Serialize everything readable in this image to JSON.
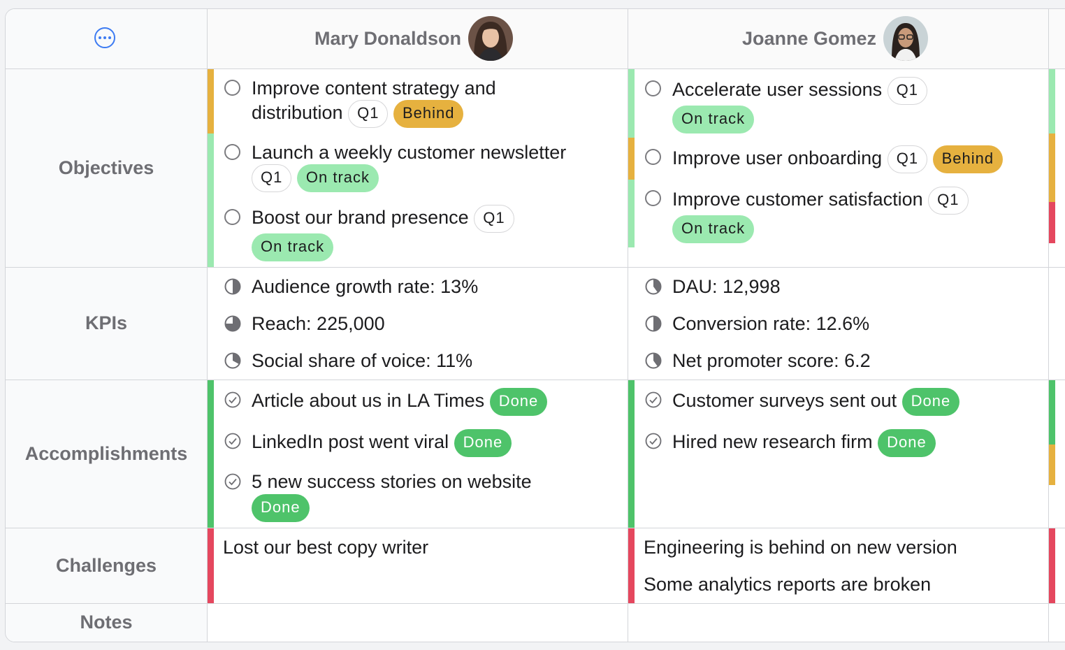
{
  "header": {
    "people": [
      {
        "name": "Mary Donaldson"
      },
      {
        "name": "Joanne Gomez"
      }
    ]
  },
  "rows": {
    "objectives": "Objectives",
    "kpis": "KPIs",
    "accomplishments": "Accomplishments",
    "challenges": "Challenges",
    "notes": "Notes"
  },
  "mary": {
    "objectives": [
      {
        "line1": "Improve content strategy and",
        "line2": "distribution",
        "quarter": "Q1",
        "status": "Behind"
      },
      {
        "line1": "Launch a weekly customer newsletter",
        "quarter": "Q1",
        "status": "On track"
      },
      {
        "line1": "Boost our brand presence",
        "quarter": "Q1",
        "status": "On track"
      }
    ],
    "kpis": [
      {
        "text": "Audience growth rate: 13%",
        "progress": 0.5
      },
      {
        "text": "Reach: 225,000",
        "progress": 0.75
      },
      {
        "text": "Social share of voice: 11%",
        "progress": 0.33
      }
    ],
    "accomplishments": [
      {
        "text": "Article about us in LA Times",
        "status": "Done"
      },
      {
        "text": "LinkedIn post went viral",
        "status": "Done"
      },
      {
        "text": "5 new success stories on website",
        "status": "Done"
      }
    ],
    "challenges": [
      "Lost our best copy writer"
    ]
  },
  "joanne": {
    "objectives": [
      {
        "line1": "Accelerate user sessions",
        "quarter": "Q1",
        "status": "On track"
      },
      {
        "line1": "Improve user onboarding",
        "quarter": "Q1",
        "status": "Behind"
      },
      {
        "line1": "Improve customer satisfaction",
        "quarter": "Q1",
        "status": "On track"
      }
    ],
    "kpis": [
      {
        "text": "DAU: 12,998",
        "progress": 0.4
      },
      {
        "text": "Conversion rate: 12.6%",
        "progress": 0.5
      },
      {
        "text": "Net promoter score: 6.2",
        "progress": 0.4
      }
    ],
    "accomplishments": [
      {
        "text": "Customer surveys sent out",
        "status": "Done"
      },
      {
        "text": "Hired new research firm",
        "status": "Done"
      }
    ],
    "challenges": [
      "Engineering is behind on new version",
      "Some analytics reports are broken"
    ]
  },
  "colors": {
    "behind": "#e6b13f",
    "on_track": "#9be9b0",
    "done": "#4ec36a",
    "challenge": "#e5475e",
    "accent": "#3d7bf2"
  }
}
